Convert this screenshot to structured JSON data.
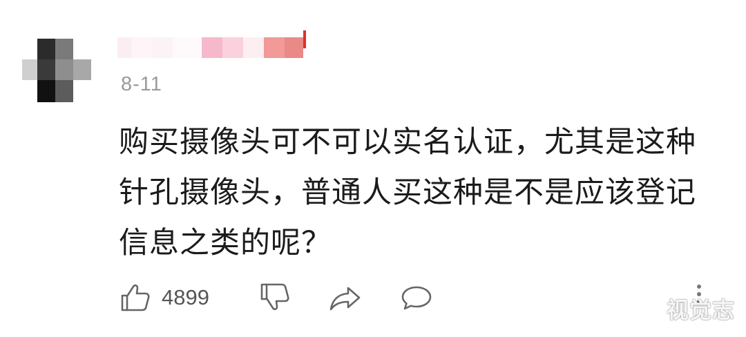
{
  "comment": {
    "date": "8-11",
    "lines": [
      "购买摄像头可不可以实名认证，尤其是这种",
      "针孔摄像头，普通人买这种是不是应该登记",
      "信息之类的呢？"
    ],
    "like_count": "4899"
  },
  "icons": {
    "like": "thumbs-up-icon",
    "dislike": "thumbs-down-icon",
    "share": "share-arrow-icon",
    "comment": "comment-bubble-icon",
    "more": "more-vertical-icon"
  },
  "colors": {
    "text": "#1b1b1b",
    "meta": "#9a9a9a",
    "icon": "#666666"
  },
  "watermark": "视觉志"
}
